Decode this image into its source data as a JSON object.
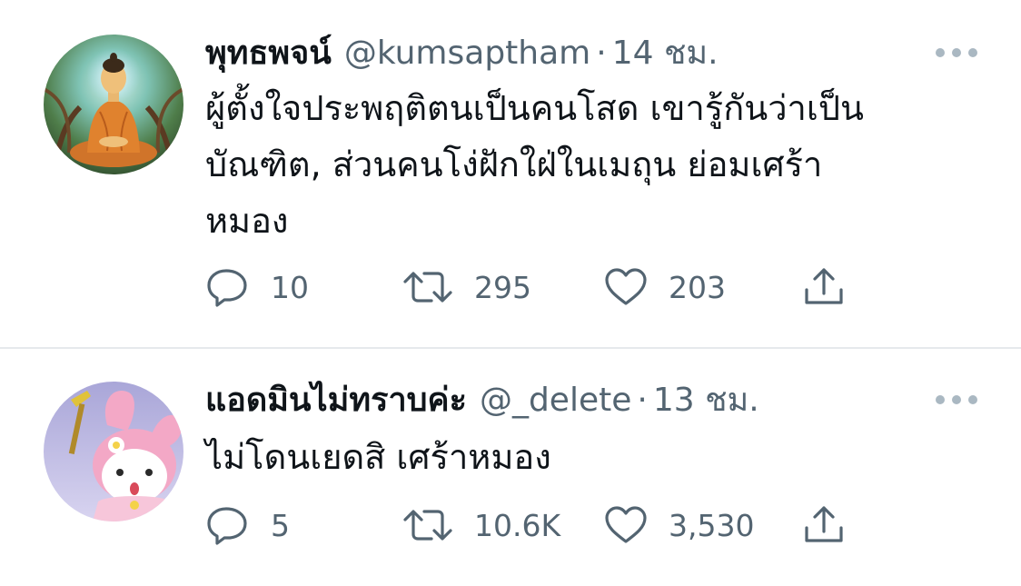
{
  "tweets": [
    {
      "display_name": "พุทธพจน์",
      "handle": "@kumsaptham",
      "separator": "·",
      "time": "14 ชม.",
      "text_lines": [
        "ผู้ตั้งใจประพฤติตนเป็นคนโสด   เขารู้กันว่าเป็น",
        "บัณฑิต,   ส่วนคนโง่ฝักใฝ่ในเมถุน  ย่อมเศร้า",
        "หมอง"
      ],
      "replies": "10",
      "retweets": "295",
      "likes": "203"
    },
    {
      "display_name": "แอดมินไม่ทราบค่ะ",
      "handle": "@_delete",
      "separator": "·",
      "time": "13 ชม.",
      "text_lines": [
        "ไม่โดนเยดสิ เศร้าหมอง"
      ],
      "replies": "5",
      "retweets": "10.6K",
      "likes": "3,530"
    }
  ],
  "icons": {
    "reply": "reply-icon",
    "retweet": "retweet-icon",
    "like": "heart-icon",
    "share": "share-icon",
    "more": "more-icon"
  },
  "colors": {
    "text": "#0f1419",
    "muted": "#536471",
    "divider": "#e6e9ec"
  }
}
